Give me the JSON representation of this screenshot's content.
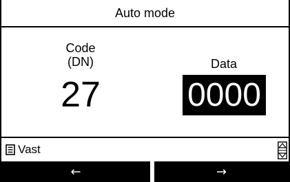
{
  "title": "Auto mode",
  "code": {
    "label_line1": "Code",
    "label_line2": "(DN)",
    "value": "27"
  },
  "data": {
    "label": "Data",
    "value": "0000"
  },
  "status": {
    "text": "Vast",
    "list_icon": "list-icon",
    "scroll_icon": "up-down-arrows-icon"
  },
  "softkeys": {
    "left": "←",
    "right": "→"
  }
}
